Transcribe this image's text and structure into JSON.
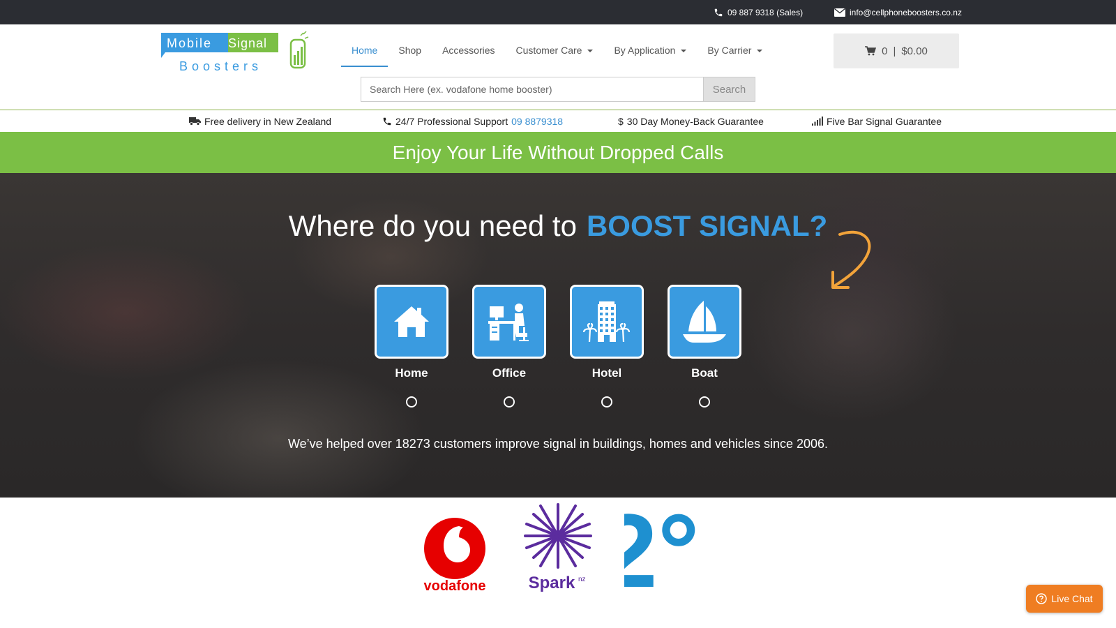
{
  "topbar": {
    "phone": "09 887 9318 (Sales)",
    "email": "info@cellphoneboosters.co.nz"
  },
  "logo": {
    "word1": "Mobile",
    "word2": "Signal",
    "word3": "Boosters"
  },
  "nav": {
    "items": [
      {
        "label": "Home",
        "active": true,
        "dropdown": false
      },
      {
        "label": "Shop",
        "active": false,
        "dropdown": false
      },
      {
        "label": "Accessories",
        "active": false,
        "dropdown": false
      },
      {
        "label": "Customer Care",
        "active": false,
        "dropdown": true
      },
      {
        "label": "By Application",
        "active": false,
        "dropdown": true
      },
      {
        "label": "By Carrier",
        "active": false,
        "dropdown": true
      }
    ]
  },
  "cart": {
    "count": "0",
    "separator": "|",
    "total": "$0.00"
  },
  "search": {
    "placeholder": "Search Here (ex. vodafone home booster)",
    "button": "Search"
  },
  "features": {
    "delivery": "Free delivery in New Zealand",
    "support": "24/7 Professional Support",
    "support_phone": "09 8879318",
    "guarantee_symbol": "$",
    "guarantee": "30 Day Money-Back Guarantee",
    "signal": "Five Bar Signal Guarantee"
  },
  "banner": {
    "text": "Enjoy Your Life Without Dropped Calls"
  },
  "hero": {
    "title": "Where do you need to",
    "title_accent": "BOOST SIGNAL?",
    "applications": [
      {
        "label": "Home",
        "icon": "house-icon"
      },
      {
        "label": "Office",
        "icon": "office-desk-icon"
      },
      {
        "label": "Hotel",
        "icon": "hotel-building-icon"
      },
      {
        "label": "Boat",
        "icon": "sailboat-icon"
      }
    ],
    "subtitle": "We’ve helped over 18273 customers improve signal in buildings, homes and vehicles since 2006."
  },
  "carriers": {
    "vodafone": "vodafone",
    "spark": "Spark",
    "spark_suffix": "nz",
    "two_degrees": "2°"
  },
  "live_chat": {
    "label": "Live Chat"
  },
  "colors": {
    "topbar": "#2b2d33",
    "accent_blue": "#3a9be0",
    "banner_green": "#7bbf45",
    "live_chat_orange": "#ef7d22"
  }
}
